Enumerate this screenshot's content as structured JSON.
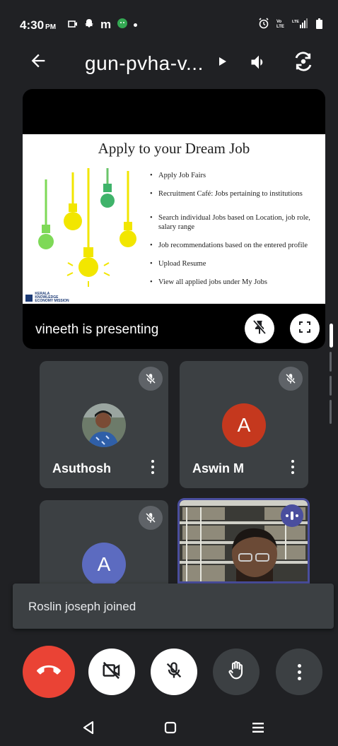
{
  "status_bar": {
    "time": "4:30",
    "ampm": "PM",
    "m_icon": "m"
  },
  "top_bar": {
    "title": "gun-pvha-v..."
  },
  "presentation": {
    "slide_title": "Apply to your Dream Job",
    "bullets": [
      "Apply Job Fairs",
      "Recruitment Café: Jobs pertaining to institutions",
      "Search individual Jobs based on Location, job role, salary range",
      "Job recommendations based on the entered profile",
      "Upload Resume",
      "View all applied jobs under My Jobs"
    ],
    "logo_lines": [
      "KERALA",
      "KNOWLEDGE",
      "ECONOMY MISSION"
    ],
    "presenting_text": "vineeth is presenting"
  },
  "participants": [
    {
      "name": "Asuthosh",
      "muted": true
    },
    {
      "name": "Aswin M",
      "initial": "A",
      "avatar_color": "#c5381e",
      "muted": true
    },
    {
      "initial": "A",
      "avatar_color": "#5c6bc0",
      "muted": true
    },
    {
      "speaking": true
    }
  ],
  "toast": {
    "message": "Roslin joseph joined"
  },
  "colors": {
    "end_call": "#ea4335",
    "background": "#202124",
    "tile": "#3c4043"
  },
  "icons": [
    "back-arrow-icon",
    "play-icon",
    "speaker-icon",
    "camera-flip-icon",
    "pin-off-icon",
    "fullscreen-icon",
    "mic-off-icon",
    "more-icon",
    "end-call-icon",
    "video-off-icon",
    "hand-raise-icon",
    "nav-back-icon",
    "nav-home-icon",
    "nav-recents-icon"
  ]
}
